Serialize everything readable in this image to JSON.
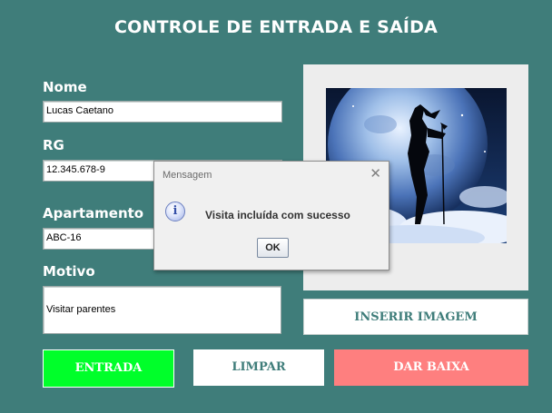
{
  "header": {
    "title": "CONTROLE DE ENTRADA E SAÍDA"
  },
  "form": {
    "nome_label": "Nome",
    "nome_value": "Lucas Caetano",
    "rg_label": "RG",
    "rg_value": "12.345.678-9",
    "apartamento_label": "Apartamento",
    "apartamento_value": "ABC-16",
    "motivo_label": "Motivo",
    "motivo_value": "Visitar parentes"
  },
  "image_panel": {
    "button_label": "INSERIR IMAGEM"
  },
  "actions": {
    "entrada_label": "ENTRADA",
    "limpar_label": "LIMPAR",
    "baixa_label": "DAR BAIXA"
  },
  "dialog": {
    "title": "Mensagem",
    "message": "Visita incluída com sucesso",
    "ok_label": "OK",
    "icon": "info-icon"
  },
  "colors": {
    "background": "#3f7d7a",
    "entrada": "#00ff2a",
    "baixa": "#fe7f7f",
    "accent_text": "#3f7d7a"
  }
}
